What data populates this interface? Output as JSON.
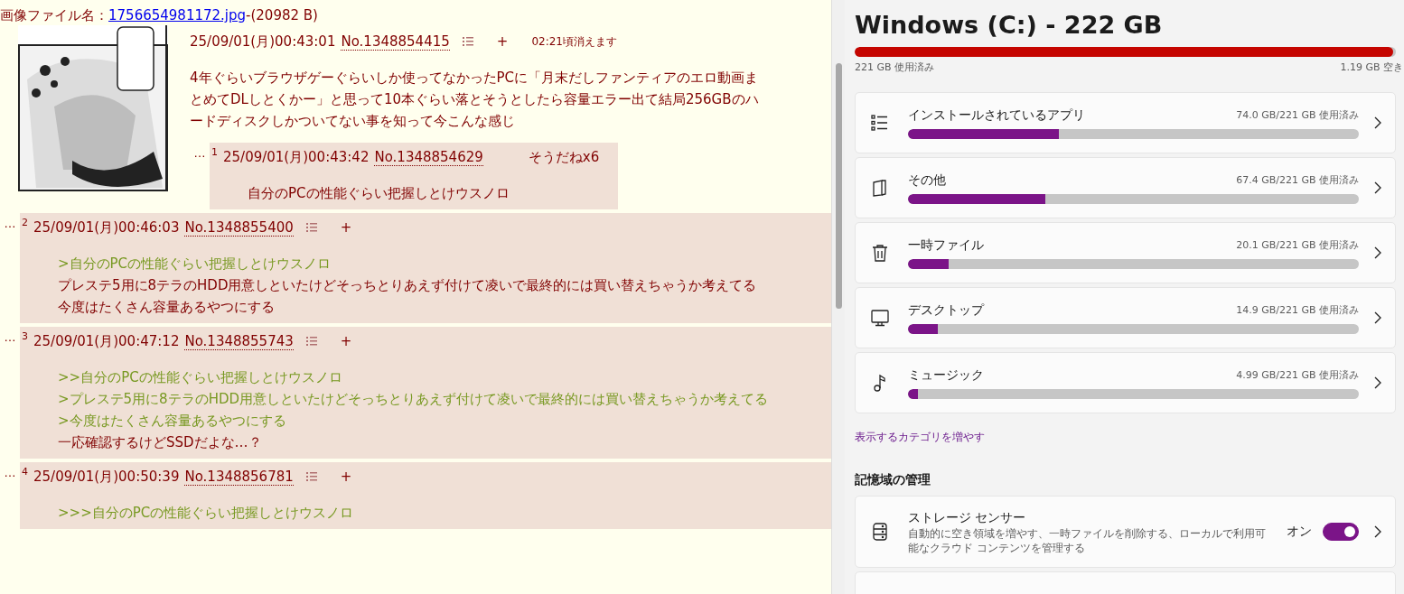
{
  "thread": {
    "file_label": "画像ファイル名：",
    "file_link": "1756654981172.jpg",
    "file_size": "-(20982 B)",
    "op": {
      "date": "25/09/01(月)00:43:01",
      "no": "No.1348854415",
      "plus": "+",
      "expire": "02:21頃消えます",
      "lines": [
        {
          "kind": "text",
          "text": "4年ぐらいブラウザゲーぐらいしか使ってなかったPCに「月末だしファンティアのエロ動画まとめてDLしとくかー」と思って10本ぐらい落とそうとしたら容量エラー出て結局256GBのハードディスクしかついてない事を知って今こんな感じ"
        }
      ]
    },
    "nested_reply": {
      "mark": "…",
      "index": "1",
      "date": "25/09/01(月)00:43:42",
      "no": "No.1348854629",
      "sodane": "そうだねx6",
      "lines": [
        {
          "kind": "text",
          "text": "自分のPCの性能ぐらい把握しとけウスノロ"
        }
      ]
    },
    "replies": [
      {
        "mark": "…",
        "index": "2",
        "date": "25/09/01(月)00:46:03",
        "no": "No.1348855400",
        "plus": "+",
        "lines": [
          {
            "kind": "quote",
            "text": ">自分のPCの性能ぐらい把握しとけウスノロ"
          },
          {
            "kind": "text",
            "text": "プレステ5用に8テラのHDD用意しといたけどそっちとりあえず付けて凌いで最終的には買い替えちゃうか考えてる"
          },
          {
            "kind": "text",
            "text": "今度はたくさん容量あるやつにする"
          }
        ]
      },
      {
        "mark": "…",
        "index": "3",
        "date": "25/09/01(月)00:47:12",
        "no": "No.1348855743",
        "plus": "+",
        "lines": [
          {
            "kind": "quote",
            "text": ">>自分のPCの性能ぐらい把握しとけウスノロ"
          },
          {
            "kind": "quote",
            "text": ">プレステ5用に8テラのHDD用意しといたけどそっちとりあえず付けて凌いで最終的には買い替えちゃうか考えてる"
          },
          {
            "kind": "quote",
            "text": ">今度はたくさん容量あるやつにする"
          },
          {
            "kind": "text",
            "text": "一応確認するけどSSDだよな…？"
          }
        ]
      },
      {
        "mark": "…",
        "index": "4",
        "date": "25/09/01(月)00:50:39",
        "no": "No.1348856781",
        "plus": "+",
        "lines": [
          {
            "kind": "quote",
            "text": ">>>自分のPCの性能ぐらい把握しとけウスノロ"
          }
        ]
      }
    ]
  },
  "storage": {
    "title": "Windows (C:) - 222 GB",
    "level": 0.995,
    "used": "221 GB 使用済み",
    "free": "1.19 GB 空き",
    "categories": [
      {
        "kind": "apps",
        "name": "インストールされているアプリ",
        "usage": "74.0 GB/221 GB 使用済み",
        "level": 0.335
      },
      {
        "kind": "other",
        "name": "その他",
        "usage": "67.4 GB/221 GB 使用済み",
        "level": 0.305
      },
      {
        "kind": "temp",
        "name": "一時ファイル",
        "usage": "20.1 GB/221 GB 使用済み",
        "level": 0.09
      },
      {
        "kind": "desktop",
        "name": "デスクトップ",
        "usage": "14.9 GB/221 GB 使用済み",
        "level": 0.067
      },
      {
        "kind": "music",
        "name": "ミュージック",
        "usage": "4.99 GB/221 GB 使用済み",
        "level": 0.022
      }
    ],
    "more_link": "表示するカテゴリを増やす",
    "section_title": "記憶域の管理",
    "sense": {
      "name": "ストレージ センサー",
      "description": "自動的に空き領域を増やす、一時ファイルを削除する、ローカルで利用可能なクラウド コンテンツを管理する",
      "state": "オン",
      "on": true
    }
  }
}
